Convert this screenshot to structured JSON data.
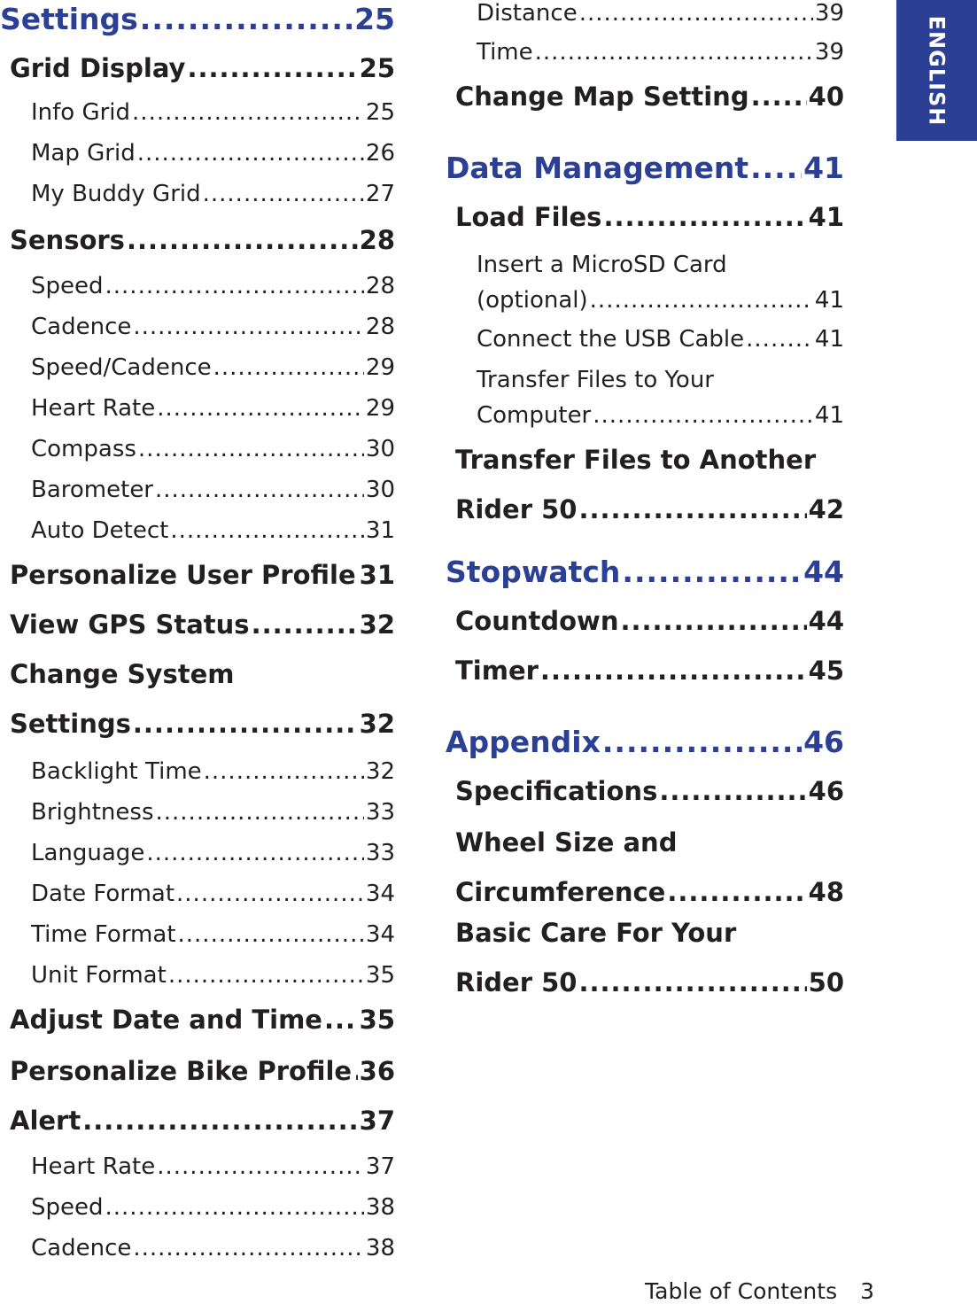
{
  "lang_tab": "ENGLISH",
  "footer": {
    "section": "Table of Contents",
    "page_number": "3"
  },
  "colors": {
    "accent": "#2b3f94",
    "text": "#231f20"
  },
  "left": [
    {
      "level": 1,
      "label": "Settings",
      "page": "25"
    },
    {
      "level": 2,
      "label": "Grid Display",
      "page": "25"
    },
    {
      "level": 3,
      "label": "Info Grid",
      "page": "25"
    },
    {
      "level": 3,
      "label": "Map Grid",
      "page": "26"
    },
    {
      "level": 3,
      "label": "My Buddy Grid",
      "page": "27"
    },
    {
      "level": 2,
      "label": "Sensors",
      "page": "28"
    },
    {
      "level": 3,
      "label": "Speed",
      "page": "28"
    },
    {
      "level": 3,
      "label": "Cadence",
      "page": "28"
    },
    {
      "level": 3,
      "label": "Speed/Cadence",
      "page": "29"
    },
    {
      "level": 3,
      "label": "Heart Rate",
      "page": "29"
    },
    {
      "level": 3,
      "label": "Compass",
      "page": "30"
    },
    {
      "level": 3,
      "label": "Barometer",
      "page": "30"
    },
    {
      "level": 3,
      "label": "Auto Detect",
      "page": "31"
    },
    {
      "level": 2,
      "label": "Personalize User Profile",
      "page": "31"
    },
    {
      "level": 2,
      "label": "View GPS Status",
      "page": "32"
    },
    {
      "level": 2,
      "label": "Change System",
      "label2": "Settings",
      "page": "32"
    },
    {
      "level": 3,
      "label": "Backlight Time",
      "page": "32"
    },
    {
      "level": 3,
      "label": "Brightness",
      "page": "33"
    },
    {
      "level": 3,
      "label": "Language",
      "page": "33"
    },
    {
      "level": 3,
      "label": "Date Format",
      "page": "34"
    },
    {
      "level": 3,
      "label": "Time Format",
      "page": "34"
    },
    {
      "level": 3,
      "label": "Unit Format",
      "page": "35"
    },
    {
      "level": 2,
      "label": "Adjust Date and Time",
      "page": "35"
    },
    {
      "level": 2,
      "label": "Personalize Bike Profile",
      "page": "36"
    },
    {
      "level": 2,
      "label": "Alert",
      "page": "37"
    },
    {
      "level": 3,
      "label": "Heart Rate",
      "page": "37"
    },
    {
      "level": 3,
      "label": "Speed",
      "page": "38"
    },
    {
      "level": 3,
      "label": "Cadence",
      "page": "38"
    }
  ],
  "right": [
    {
      "level": 3,
      "label": "Distance",
      "page": "39"
    },
    {
      "level": 3,
      "label": "Time",
      "page": "39"
    },
    {
      "level": 2,
      "label": "Change Map Setting",
      "page": "40"
    },
    {
      "level": 1,
      "label": "Data Management",
      "page": "41"
    },
    {
      "level": 2,
      "label": "Load Files",
      "page": "41"
    },
    {
      "level": 3,
      "label": "Insert a MicroSD Card",
      "label2": "(optional)",
      "page": "41"
    },
    {
      "level": 3,
      "label": "Connect the USB Cable",
      "page": "41"
    },
    {
      "level": 3,
      "label": "Transfer Files to Your",
      "label2": "Computer",
      "page": "41"
    },
    {
      "level": 2,
      "label": "Transfer Files to Another",
      "label2": "Rider 50",
      "page": "42"
    },
    {
      "level": 1,
      "label": "Stopwatch",
      "page": "44"
    },
    {
      "level": 2,
      "label": "Countdown",
      "page": "44"
    },
    {
      "level": 2,
      "label": "Timer",
      "page": "45"
    },
    {
      "level": 1,
      "label": "Appendix",
      "page": "46"
    },
    {
      "level": 2,
      "label": "Specifications",
      "page": "46"
    },
    {
      "level": 2,
      "label": "Wheel Size and",
      "label2": "Circumference",
      "page": "48"
    },
    {
      "level": 2,
      "label": "Basic Care For Your",
      "label2": "Rider 50",
      "page": "50"
    }
  ]
}
